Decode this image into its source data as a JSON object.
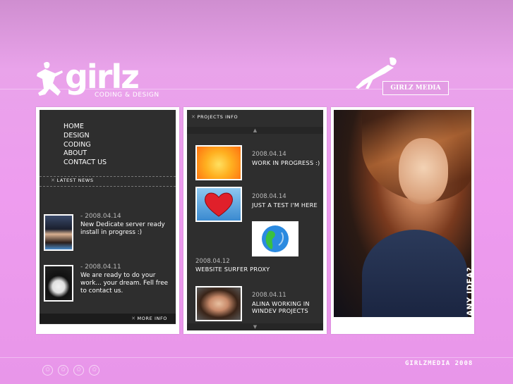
{
  "header": {
    "logo_word": "girlz",
    "logo_sub": "CODING & DESIGN",
    "brand_box": "GIRLZ MEDIA"
  },
  "nav": {
    "items": [
      "HOME",
      "DESIGN",
      "CODING",
      "ABOUT",
      "CONTACT US"
    ]
  },
  "latest_news": {
    "title": "LATEST NEWS",
    "items": [
      {
        "date": "- 2008.04.14",
        "text": "New Dedicate server ready install in progress :)"
      },
      {
        "date": "- 2008.04.11",
        "text": "We are ready to do your work... your dream. Fell free to contact us."
      }
    ],
    "more_label": "MORE INFO"
  },
  "projects": {
    "title": "PROJECTS INFO",
    "up_arrow": "▲",
    "down_arrow": "▼",
    "items": [
      {
        "date": "2008.04.14",
        "title": "WORK IN PROGRESS :)"
      },
      {
        "date": "2008.04.14",
        "title": "JUST A TEST I'M HERE"
      },
      {
        "date": "2008.04.12",
        "title": "WEBSITE SURFER PROXY"
      },
      {
        "date": "2008.04.11",
        "title": "ALINA WORKING IN WINDEV PROJECTS"
      }
    ]
  },
  "photo_panel": {
    "label": "ANY IDEA?"
  },
  "footer": {
    "copyright": "GIRLZMEDIA 2008",
    "star_glyph": "✩"
  },
  "colors": {
    "background": "#ee9cef",
    "panel_dark": "#2e2e2e",
    "panel_border": "#ffffff"
  }
}
